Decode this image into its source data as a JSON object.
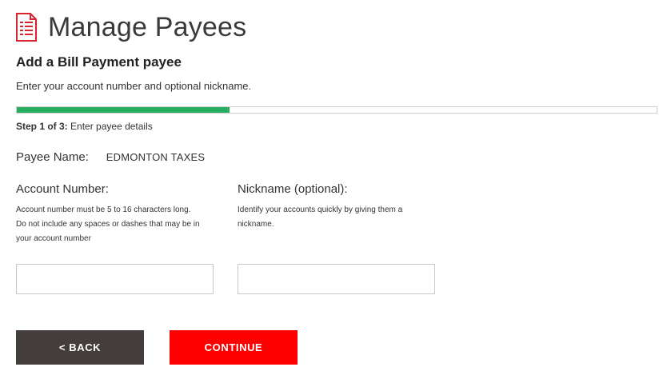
{
  "header": {
    "title": "Manage Payees",
    "icon": "document-icon",
    "icon_color": "#d9232e"
  },
  "form": {
    "heading": "Add a Bill Payment payee",
    "instructions": "Enter your account number and optional nickname.",
    "progress": {
      "fraction": 0.333,
      "color": "#27ae60",
      "step_label": "Step 1 of 3:",
      "step_desc": "Enter payee details"
    },
    "payee": {
      "label": "Payee Name:",
      "value": "EDMONTON TAXES"
    },
    "account": {
      "label": "Account Number:",
      "help_lines": [
        "Account number must be 5 to 16 characters long.",
        "Do not include any spaces or dashes that may be in",
        "your account number"
      ],
      "value": ""
    },
    "nickname": {
      "label": "Nickname (optional):",
      "help_lines": [
        "Identify your accounts quickly by giving them a",
        "nickname."
      ],
      "value": ""
    }
  },
  "buttons": {
    "back": "< BACK",
    "continue": "CONTINUE",
    "back_color": "#433e3b",
    "continue_color": "#ff0000"
  }
}
